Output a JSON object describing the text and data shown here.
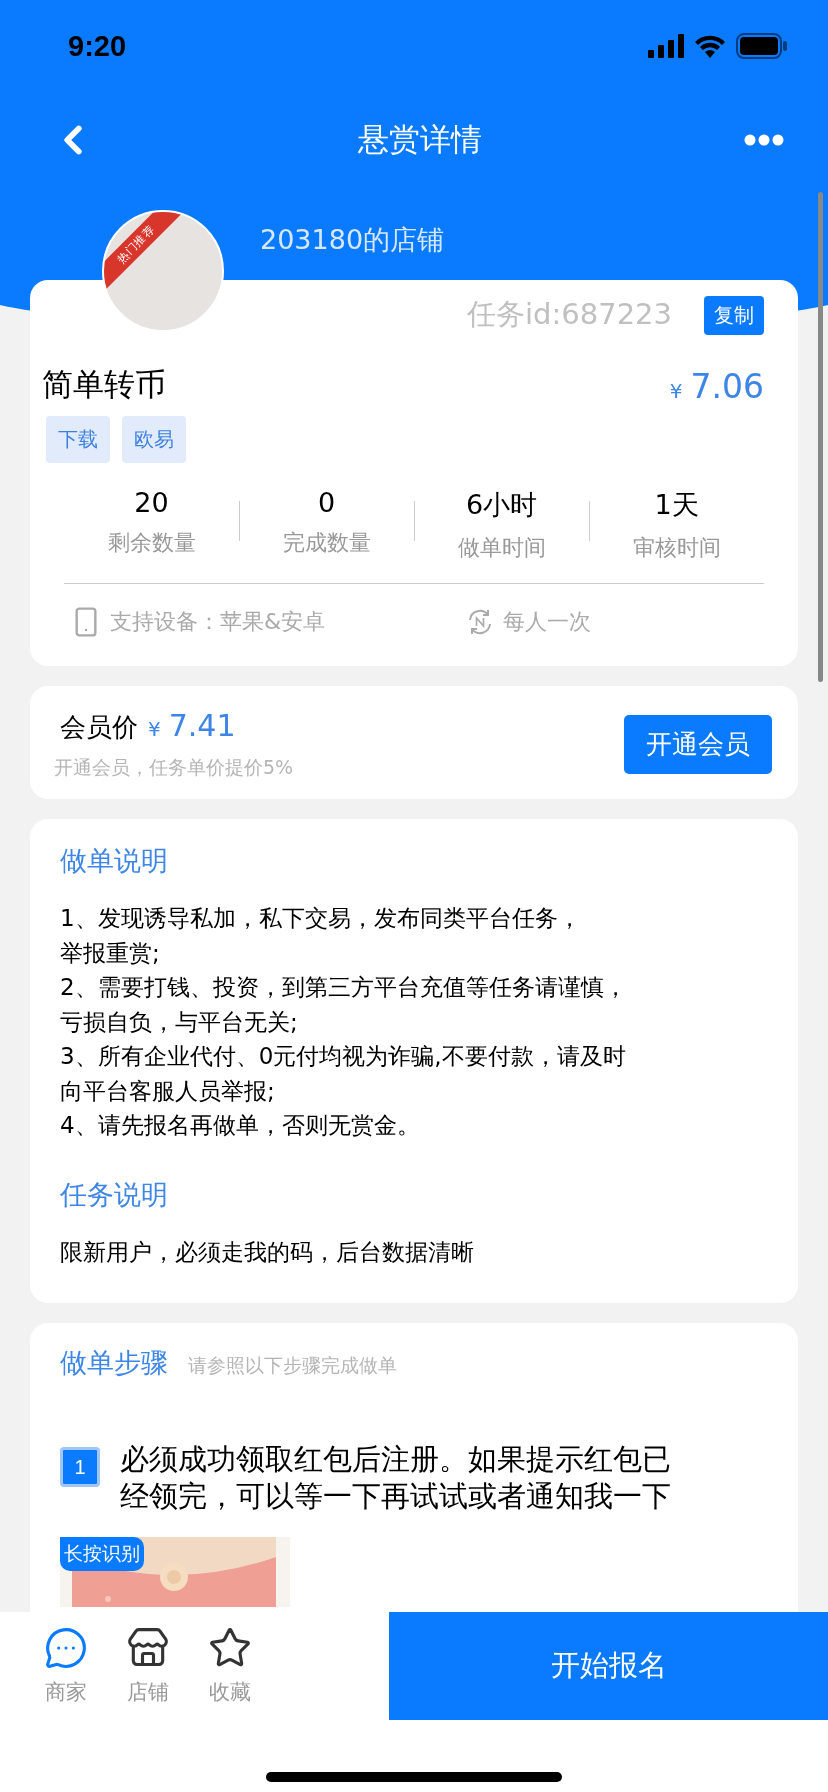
{
  "status_bar": {
    "time": "9:20"
  },
  "nav": {
    "title": "悬赏详情"
  },
  "shop": {
    "name": "203180的店铺",
    "avatar_badge": "热门推荐"
  },
  "task": {
    "id_text": "任务id:687223",
    "copy_button": "复制",
    "title": "简单转币",
    "currency": "¥",
    "price": "7.06",
    "tags": [
      "下载",
      "欧易"
    ],
    "stats": [
      {
        "value": "20",
        "label": "剩余数量"
      },
      {
        "value": "0",
        "label": "完成数量"
      },
      {
        "value": "6小时",
        "label": "做单时间"
      },
      {
        "value": "1天",
        "label": "审核时间"
      }
    ],
    "device": "支持设备：苹果&安卓",
    "frequency": "每人一次"
  },
  "member": {
    "label": "会员价",
    "currency": "¥",
    "price": "7.41",
    "note": "开通会员，任务单价提价5%",
    "button": "开通会员"
  },
  "instructions": [
    {
      "title": "做单说明",
      "lines": [
        "1、发现诱导私加，私下交易，发布同类平台任务，",
        "举报重赏;",
        "2、需要打钱、投资，到第三方平台充值等任务请谨慎，",
        "亏损自负，与平台无关;",
        "3、所有企业代付、0元付均视为诈骗,不要付款，请及时",
        "向平台客服人员举报;",
        "4、请先报名再做单，否则无赏金。"
      ]
    },
    {
      "title": "任务说明",
      "lines": [
        "限新用户，必须走我的码，后台数据清晰"
      ]
    }
  ],
  "steps": {
    "title": "做单步骤",
    "hint": "请参照以下步骤完成做单",
    "items": [
      {
        "number": "1",
        "lines": [
          "必须成功领取红包后注册。如果提示红包已",
          "经领完，可以等一下再试试或者通知我一下"
        ],
        "image_badge": "长按识别"
      }
    ]
  },
  "bottom_bar": {
    "tabs": [
      {
        "kind": "chat",
        "label": "商家",
        "selected": true
      },
      {
        "kind": "store",
        "label": "店铺",
        "selected": false
      },
      {
        "kind": "star",
        "label": "收藏",
        "selected": false
      }
    ],
    "primary_button": "开始报名"
  }
}
